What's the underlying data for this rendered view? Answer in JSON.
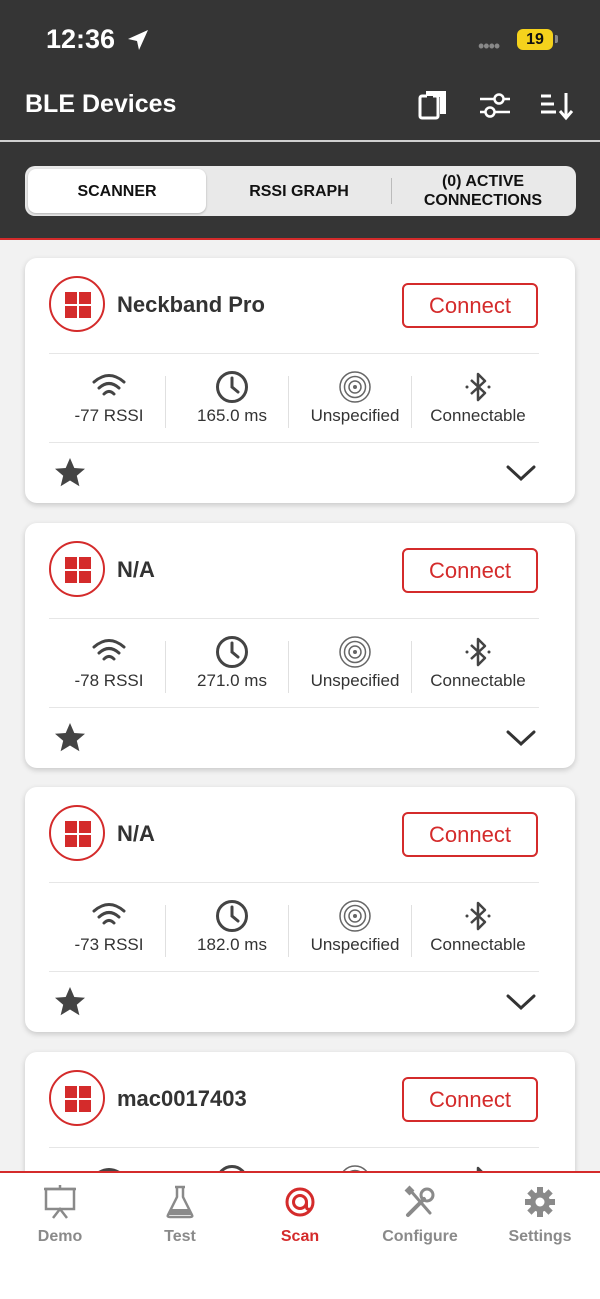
{
  "status_bar": {
    "time": "12:36",
    "battery": "19"
  },
  "header": {
    "title": "BLE Devices",
    "icons": [
      "bookmarks-icon",
      "filter-sliders-icon",
      "sort-icon"
    ]
  },
  "tabs": [
    {
      "label": "SCANNER",
      "active": true
    },
    {
      "label": "RSSI GRAPH",
      "active": false
    },
    {
      "label": "(0) ACTIVE\nCONNECTIONS",
      "active": false
    }
  ],
  "devices": [
    {
      "name": "Neckband Pro",
      "connect_label": "Connect",
      "rssi": "-77 RSSI",
      "interval": "165.0 ms",
      "type": "Unspecified",
      "connectable": "Connectable"
    },
    {
      "name": "N/A",
      "connect_label": "Connect",
      "rssi": "-78 RSSI",
      "interval": "271.0 ms",
      "type": "Unspecified",
      "connectable": "Connectable"
    },
    {
      "name": "N/A",
      "connect_label": "Connect",
      "rssi": "-73 RSSI",
      "interval": "182.0 ms",
      "type": "Unspecified",
      "connectable": "Connectable"
    },
    {
      "name": "mac0017403",
      "connect_label": "Connect",
      "rssi": "",
      "interval": "",
      "type": "",
      "connectable": ""
    }
  ],
  "bottom_nav": [
    {
      "label": "Demo",
      "icon": "presentation-board-icon",
      "active": false
    },
    {
      "label": "Test",
      "icon": "flask-icon",
      "active": false
    },
    {
      "label": "Scan",
      "icon": "scan-target-icon",
      "active": true
    },
    {
      "label": "Configure",
      "icon": "tools-icon",
      "active": false
    },
    {
      "label": "Settings",
      "icon": "gear-icon",
      "active": false
    }
  ],
  "colors": {
    "accent": "#d42b2b",
    "header_bg": "#353535",
    "battery": "#f5d21c"
  }
}
